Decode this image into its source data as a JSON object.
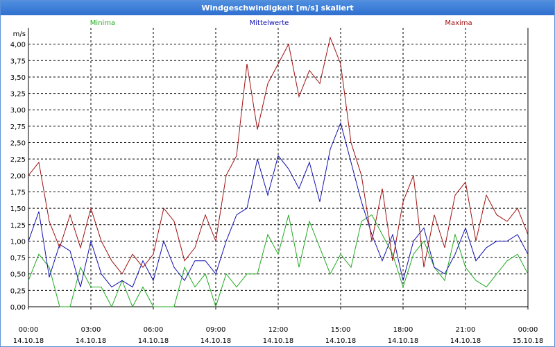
{
  "window": {
    "title": "Windgeschwindigkeit [m/s] skaliert"
  },
  "chart_data": {
    "type": "line",
    "title": "Windgeschwindigkeit [m/s] skaliert",
    "ylabel": "m/s",
    "xlabel": "",
    "ylim": [
      0,
      4.25
    ],
    "xlim": [
      0,
      24
    ],
    "grid": true,
    "legend_position": "top",
    "y_ticks": [
      "0,00",
      "0,25",
      "0,50",
      "0,75",
      "1,00",
      "1,25",
      "1,50",
      "1,75",
      "2,00",
      "2,25",
      "2,50",
      "2,75",
      "3,00",
      "3,25",
      "3,50",
      "3,75",
      "4,00"
    ],
    "x_ticks": [
      {
        "time": "00:00",
        "date": "14.10.18"
      },
      {
        "time": "03:00",
        "date": "14.10.18"
      },
      {
        "time": "06:00",
        "date": "14.10.18"
      },
      {
        "time": "09:00",
        "date": "14.10.18"
      },
      {
        "time": "12:00",
        "date": "14.10.18"
      },
      {
        "time": "15:00",
        "date": "14.10.18"
      },
      {
        "time": "18:00",
        "date": "14.10.18"
      },
      {
        "time": "21:00",
        "date": "14.10.18"
      },
      {
        "time": "00:00",
        "date": "15.10.18"
      }
    ],
    "series": [
      {
        "name": "Minima",
        "color": "#22aa22",
        "x": [
          0,
          0.5,
          1,
          1.5,
          2,
          2.5,
          3,
          3.5,
          4,
          4.5,
          5,
          5.5,
          6,
          6.5,
          7,
          7.5,
          8,
          8.5,
          9,
          9.5,
          10,
          10.5,
          11,
          11.5,
          12,
          12.5,
          13,
          13.5,
          14,
          14.5,
          15,
          15.5,
          16,
          16.5,
          17,
          17.5,
          18,
          18.5,
          19,
          19.5,
          20,
          20.5,
          21,
          21.5,
          22,
          22.5,
          23,
          23.5,
          24
        ],
        "values": [
          0.4,
          0.8,
          0.6,
          0,
          0,
          0.6,
          0.3,
          0.3,
          0,
          0.4,
          0,
          0.3,
          0,
          0,
          0,
          0.6,
          0.3,
          0.5,
          0,
          0.5,
          0.3,
          0.5,
          0.5,
          1.1,
          0.8,
          1.4,
          0.6,
          1.3,
          0.9,
          0.5,
          0.8,
          0.6,
          1.3,
          1.4,
          1.1,
          0.8,
          0.3,
          0.8,
          1.0,
          0.6,
          0.4,
          1.1,
          0.6,
          0.4,
          0.3,
          0.5,
          0.7,
          0.8,
          0.5
        ]
      },
      {
        "name": "Mittelwerte",
        "color": "#1010b0",
        "x": [
          0,
          0.5,
          1,
          1.5,
          2,
          2.5,
          3,
          3.5,
          4,
          4.5,
          5,
          5.5,
          6,
          6.5,
          7,
          7.5,
          8,
          8.5,
          9,
          9.5,
          10,
          10.5,
          11,
          11.5,
          12,
          12.5,
          13,
          13.5,
          14,
          14.5,
          15,
          15.5,
          16,
          16.5,
          17,
          17.5,
          18,
          18.5,
          19,
          19.5,
          20,
          20.5,
          21,
          21.5,
          22,
          22.5,
          23,
          23.5,
          24
        ],
        "values": [
          1.0,
          1.45,
          0.45,
          0.95,
          0.85,
          0.3,
          1.0,
          0.5,
          0.3,
          0.4,
          0.3,
          0.7,
          0.4,
          1.0,
          0.6,
          0.4,
          0.7,
          0.7,
          0.5,
          1.0,
          1.4,
          1.5,
          2.25,
          1.7,
          2.3,
          2.1,
          1.8,
          2.2,
          1.6,
          2.4,
          2.8,
          2.2,
          1.6,
          1.1,
          0.7,
          1.1,
          0.4,
          1.0,
          1.2,
          0.6,
          0.5,
          0.8,
          1.2,
          0.7,
          0.9,
          1.0,
          1.0,
          1.1,
          0.8
        ]
      },
      {
        "name": "Maxima",
        "color": "#a01010",
        "x": [
          0,
          0.5,
          1,
          1.5,
          2,
          2.5,
          3,
          3.5,
          4,
          4.5,
          5,
          5.5,
          6,
          6.5,
          7,
          7.5,
          8,
          8.5,
          9,
          9.5,
          10,
          10.5,
          11,
          11.5,
          12,
          12.5,
          13,
          13.5,
          14,
          14.5,
          15,
          15.5,
          16,
          16.5,
          17,
          17.5,
          18,
          18.5,
          19,
          19.5,
          20,
          20.5,
          21,
          21.5,
          22,
          22.5,
          23,
          23.5,
          24
        ],
        "values": [
          2.0,
          2.2,
          1.3,
          0.9,
          1.4,
          0.9,
          1.5,
          1.0,
          0.7,
          0.5,
          0.8,
          0.6,
          0.8,
          1.5,
          1.3,
          0.7,
          0.9,
          1.4,
          1.0,
          2.0,
          2.3,
          3.7,
          2.7,
          3.4,
          3.7,
          4.0,
          3.2,
          3.6,
          3.4,
          4.1,
          3.7,
          2.5,
          2.0,
          1.0,
          1.8,
          0.7,
          1.6,
          2.0,
          0.6,
          1.4,
          0.9,
          1.7,
          1.9,
          1.0,
          1.7,
          1.4,
          1.3,
          1.5,
          1.1
        ]
      }
    ]
  }
}
